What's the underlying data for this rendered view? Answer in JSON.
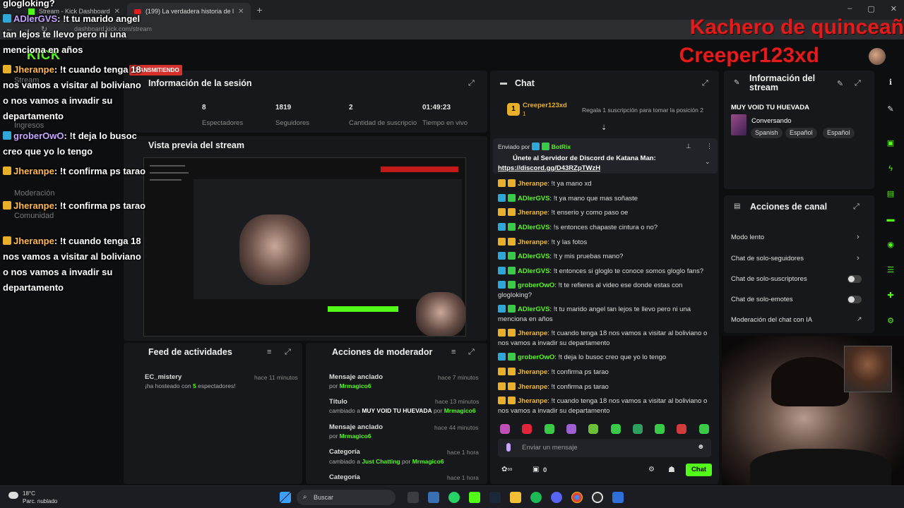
{
  "browser": {
    "tabs": [
      {
        "label": "Stream - Kick Dashboard"
      },
      {
        "label": "(199) La verdadera historia de l"
      }
    ],
    "url": "dashboard.kick.com/stream"
  },
  "session": {
    "title": "Información de la sesión",
    "live_label": "TRANSMITIENDO",
    "stats": [
      {
        "value": "8",
        "label": "Espectadores"
      },
      {
        "value": "1819",
        "label": "Seguidores"
      },
      {
        "value": "2",
        "label": "Cantidad de suscripciones"
      },
      {
        "value": "01:49:23",
        "label": "Tiempo en vivo"
      }
    ]
  },
  "preview": {
    "title": "Vista previa del stream"
  },
  "activity": {
    "title": "Feed de actividades",
    "items": [
      {
        "name": "EC_mistery",
        "text_pre": "¡ha hosteado con ",
        "count": "5",
        "text_post": " espectadores!",
        "time": "hace 11 minutos"
      }
    ]
  },
  "modactions": {
    "title": "Acciones de moderador",
    "items": [
      {
        "action": "Mensaje anclado",
        "by_label": "por",
        "user": "Mrmagico6",
        "time": "hace 7 minutos"
      },
      {
        "action": "Título",
        "detail_pre": "cambiado a",
        "detail": "MUY VOID TU HUEVADA",
        "by_label": "por",
        "user": "Mrmagico6",
        "time": "hace 13 minutos"
      },
      {
        "action": "Mensaje anclado",
        "by_label": "por",
        "user": "Mrmagico6",
        "time": "hace 44 minutos"
      },
      {
        "action": "Categoría",
        "detail_pre": "cambiado a",
        "detail": "Just Chatting",
        "by_label": "por",
        "user": "Mrmagico6",
        "time": "hace 1 hora"
      },
      {
        "action": "Categoría",
        "time": "hace 1 hora"
      }
    ]
  },
  "chat": {
    "title": "Chat",
    "top_gifter": {
      "name": "Creeper123xd",
      "count": "1",
      "prompt": "Regala 1 suscripción para tomar la posición 2"
    },
    "pinned": {
      "sent_by": "Enviado por",
      "bot": "BotRix",
      "text": "Únete al Servidor de Discord de Katana Man:",
      "link": "https://discord.gg/D43RZpTWzH"
    },
    "messages": [
      {
        "user": "Jheranpe",
        "color": "o",
        "text": "!t ya mano xd"
      },
      {
        "user": "ADlerGVS",
        "color": "g",
        "text": "!t ya mano que mas soñaste"
      },
      {
        "user": "Jheranpe",
        "color": "o",
        "text": "!t enserio y como paso oe"
      },
      {
        "user": "ADlerGVS",
        "color": "g",
        "text": "!s entonces chapaste cintura o no?"
      },
      {
        "user": "Jheranpe",
        "color": "o",
        "text": "!t y las fotos"
      },
      {
        "user": "ADlerGVS",
        "color": "g",
        "text": "!t y mis pruebas mano?"
      },
      {
        "user": "ADlerGVS",
        "color": "g",
        "text": "!t entonces si gloglo te conoce somos gloglo fans?"
      },
      {
        "user": "groberOwO",
        "color": "g",
        "text": "!t te refieres al video ese donde estas con glogloking?"
      },
      {
        "user": "ADlerGVS",
        "color": "g",
        "text": "!t tu marido angel tan lejos te llevo pero ni una menciona en años"
      },
      {
        "user": "Jheranpe",
        "color": "o",
        "text": "!t cuando tenga 18 nos vamos a visitar al boliviano o nos vamos a invadir su departamento"
      },
      {
        "user": "groberOwO",
        "color": "g",
        "text": "!t deja lo busoc creo que yo lo tengo"
      },
      {
        "user": "Jheranpe",
        "color": "o",
        "text": "!t confirma ps tarao"
      },
      {
        "user": "Jheranpe",
        "color": "o",
        "text": "!t confirma ps tarao"
      },
      {
        "user": "Jheranpe",
        "color": "o",
        "text": "!t cuando tenga 18 nos vamos a visitar al boliviano o nos vamos a invadir su departamento"
      }
    ],
    "input_placeholder": "Enviar un mensaje",
    "points": "0",
    "send_label": "Chat"
  },
  "stream_info": {
    "title": "Información del stream",
    "stream_title": "MUY VOID TU HUEVADA",
    "category": "Conversando",
    "tags": [
      "Spanish",
      "Español",
      "Español"
    ]
  },
  "channel_actions": {
    "title": "Acciones de canal",
    "items": [
      {
        "label": "Modo lento",
        "kind": "chevron"
      },
      {
        "label": "Chat de solo-seguidores",
        "kind": "chevron"
      },
      {
        "label": "Chat de solo-suscriptores",
        "kind": "toggle"
      },
      {
        "label": "Chat de solo-emotes",
        "kind": "toggle"
      },
      {
        "label": "Moderación del chat con IA",
        "kind": "external"
      }
    ]
  },
  "sidebar": {
    "items": [
      "Stream",
      "Ingresos",
      "Moderación",
      "Comunidad"
    ]
  },
  "overlay": {
    "top_fragment": "glogloking?",
    "lines": [
      {
        "user": "ADlerGVS",
        "text": ": !t tu marido angel tan lejos te llevo pero ni una menciona en años"
      },
      {
        "user": "Jheranpe",
        "text": ": !t cuando tenga 18 nos vamos a visitar al boliviano o nos vamos a invadir su departamento"
      },
      {
        "user": "groberOwO",
        "text": ": !t deja lo busoc creo que yo lo tengo"
      },
      {
        "user": "Jheranpe",
        "text": ": !t confirma ps tarao"
      },
      {
        "user": "Jheranpe",
        "text": ": !t confirma ps tarao"
      },
      {
        "user": "Jheranpe",
        "text": ": !t cuando tenga 18 nos vamos a visitar al boliviano o nos vamos a invadir su departamento"
      }
    ],
    "title_line1": "Kachero de quinceañ",
    "title_line2": "Creeper123xd"
  },
  "taskbar": {
    "temp": "18°C",
    "weather": "Parc. nublado",
    "search": "Buscar"
  },
  "colors": {
    "accent": "#53fc18",
    "live": "#d8302b",
    "overlay_title": "#e21b1b"
  }
}
